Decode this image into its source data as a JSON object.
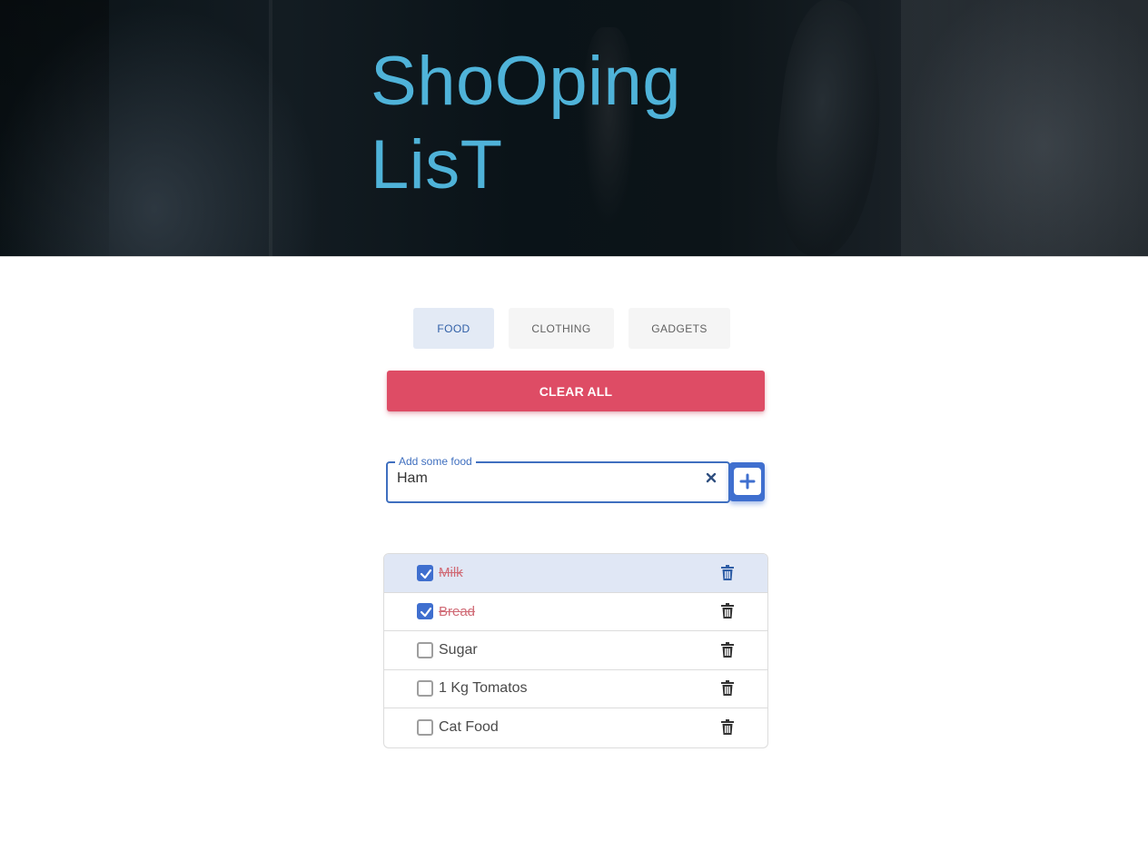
{
  "header": {
    "title_line1": "ShoOping",
    "title_line2": "LisT"
  },
  "tabs": [
    {
      "label": "FOOD",
      "active": true
    },
    {
      "label": "CLOTHING",
      "active": false
    },
    {
      "label": "GADGETS",
      "active": false
    }
  ],
  "clear_all_label": "CLEAR ALL",
  "input": {
    "label": "Add some food",
    "value": "Ham"
  },
  "items": [
    {
      "label": "Milk",
      "checked": true
    },
    {
      "label": "Bread",
      "checked": true
    },
    {
      "label": "Sugar",
      "checked": false
    },
    {
      "label": "1 Kg Tomatos",
      "checked": false
    },
    {
      "label": "Cat Food",
      "checked": false
    }
  ],
  "colors": {
    "title": "#4fb3d9",
    "accent": "#3f6fcf",
    "danger": "#de4c65",
    "done_text": "#d06a75"
  },
  "icons": {
    "clear_input": "close-icon",
    "add": "plus-icon",
    "delete": "trash-icon",
    "check": "check-icon"
  }
}
